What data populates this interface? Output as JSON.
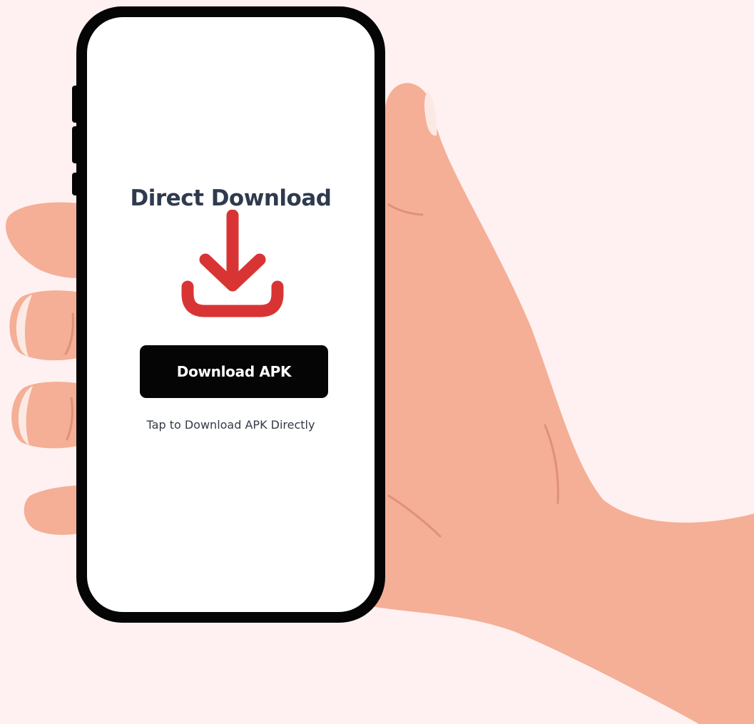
{
  "screen": {
    "title": "Direct Download",
    "button_label": "Download APK",
    "caption": "Tap to Download APK Directly"
  },
  "icons": {
    "download": "download-arrow-icon"
  },
  "colors": {
    "background": "#fff1f1",
    "skin": "#f4af96",
    "skin_line": "#e0907a",
    "nail": "#fde9e4",
    "phone_frame": "#050505",
    "accent": "#d93434",
    "title_text": "#2f3a4d",
    "button_bg": "#050505",
    "button_text": "#ffffff"
  }
}
